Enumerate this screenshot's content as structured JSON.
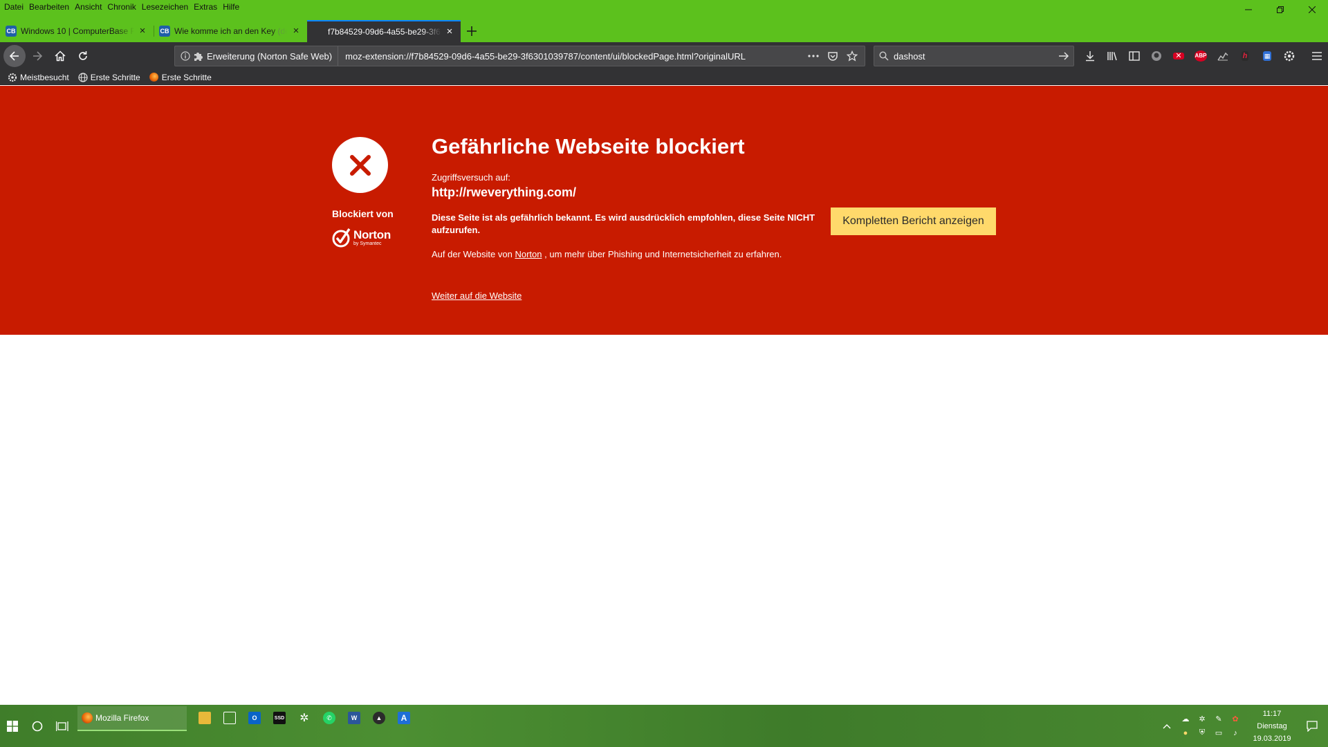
{
  "menu": [
    "Datei",
    "Bearbeiten",
    "Ansicht",
    "Chronik",
    "Lesezeichen",
    "Extras",
    "Hilfe"
  ],
  "tabs": [
    {
      "title": "Windows 10 | ComputerBase F",
      "title_fade": "o",
      "favicon": "CB",
      "active": false
    },
    {
      "title": "Wie komme ich an den Key ",
      "title_fade": "(de",
      "favicon": "CB",
      "active": false
    },
    {
      "title": "f7b84529-09d6-4a55-be29-3f63",
      "title_fade": "",
      "favicon": "",
      "active": true
    }
  ],
  "urlbar": {
    "identity_label": "Erweiterung (Norton Safe Web)",
    "url": "moz-extension://f7b84529-09d6-4a55-be29-3f6301039787/content/ui/blockedPage.html?originalURL"
  },
  "search": {
    "value": "dashost"
  },
  "bookmarks": [
    "Meistbesucht",
    "Erste Schritte",
    "Erste Schritte"
  ],
  "blocked_page": {
    "headline": "Gefährliche Webseite blockiert",
    "access_label": "Zugriffsversuch auf:",
    "blocked_url": "http://rweverything.com/",
    "warning": "Diese Seite ist als gefährlich bekannt. Es wird ausdrücklich empfohlen, diese Seite NICHT aufzurufen.",
    "info_prefix": "Auf der Website von",
    "info_link": "Norton",
    "info_suffix": ", um mehr über Phishing und Internetsicherheit zu erfahren.",
    "continue_link": "Weiter auf die Website",
    "report_button": "Kompletten Bericht anzeigen",
    "blocked_by": "Blockiert von",
    "norton_name": "Norton",
    "norton_sub": "by Symantec",
    "accent_color": "#c81b00",
    "button_color": "#ffd96b"
  },
  "taskbar": {
    "active_app": "Mozilla Firefox",
    "clock_time": "11:17",
    "clock_day": "Dienstag",
    "clock_date": "19.03.2019"
  },
  "colors": {
    "titlebar": "#5cc11d",
    "toolbar": "#323234"
  }
}
